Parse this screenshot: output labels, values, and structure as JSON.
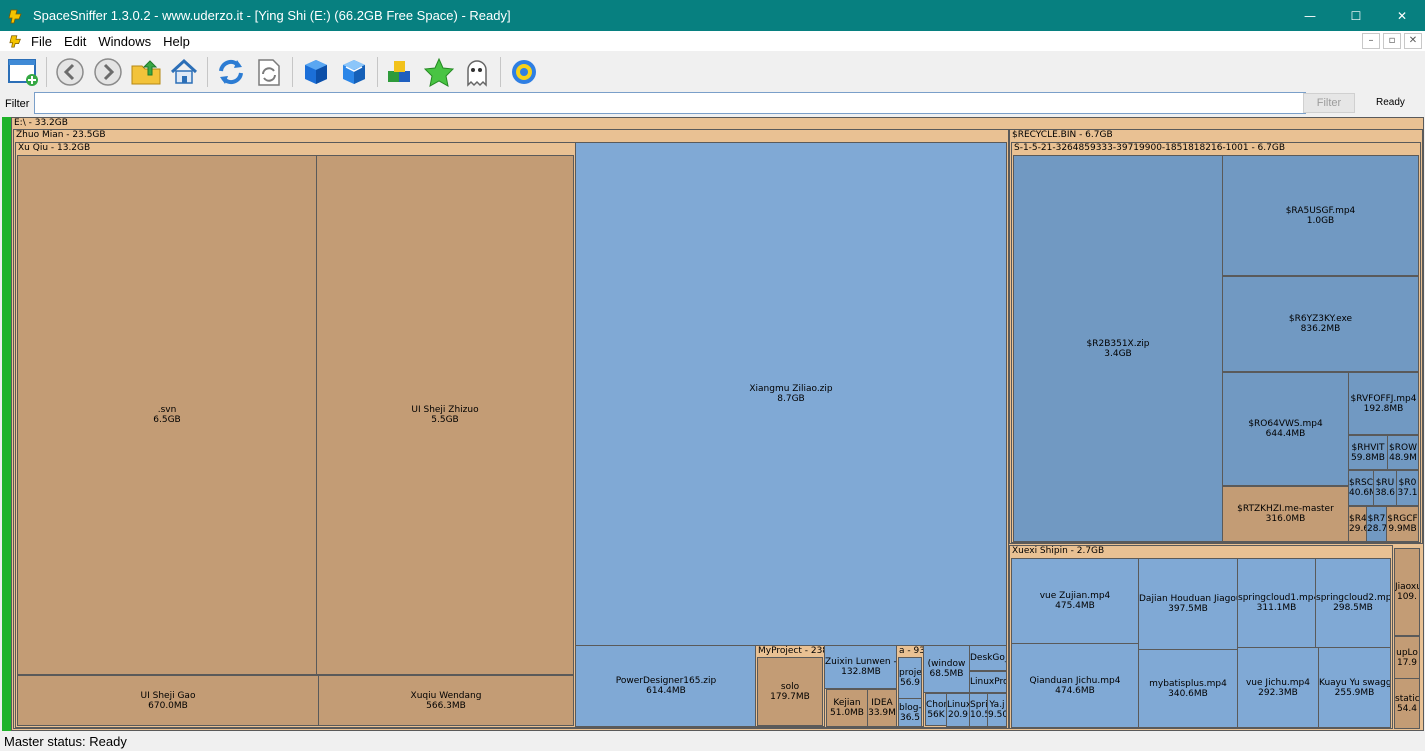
{
  "window": {
    "title": "SpaceSniffer 1.3.0.2 - www.uderzo.it - [Ying Shi (E:) (66.2GB Free Space) - Ready]",
    "minimize_glyph": "—",
    "maximize_glyph": "☐",
    "close_glyph": "✕"
  },
  "menu": {
    "items": [
      "File",
      "Edit",
      "Windows",
      "Help"
    ],
    "mdi_buttons": [
      "–",
      "▫",
      "✕"
    ]
  },
  "toolbar": {
    "buttons": [
      {
        "name": "new-view-button",
        "icon": "new-window-icon"
      },
      {
        "name": "back-button",
        "icon": "arrow-left-icon"
      },
      {
        "name": "forward-button",
        "icon": "arrow-right-icon"
      },
      {
        "name": "parent-folder-button",
        "icon": "folder-up-icon"
      },
      {
        "name": "home-button",
        "icon": "home-icon"
      },
      {
        "name": "refresh-button",
        "icon": "refresh-icon"
      },
      {
        "name": "refresh-item-button",
        "icon": "refresh-document-icon"
      },
      {
        "name": "zoom-in-button",
        "icon": "blue-cube-icon"
      },
      {
        "name": "zoom-out-button",
        "icon": "blue-cube-outline-icon"
      },
      {
        "name": "tags-button",
        "icon": "colored-blocks-icon"
      },
      {
        "name": "favorites-button",
        "icon": "star-icon"
      },
      {
        "name": "ghost-button",
        "icon": "ghost-icon"
      },
      {
        "name": "settings-button",
        "icon": "gear-icon"
      }
    ]
  },
  "filter": {
    "label": "Filter",
    "value": "",
    "button_label": "Filter",
    "status": "Ready"
  },
  "colors": {
    "titlebar": "#078080",
    "folder": "#e9c193",
    "file_brown": "#c39c75",
    "file_blue": "#80a9d5",
    "recycle_blue": "#7199c2",
    "progress_green": "#1fb32a"
  },
  "treemap": {
    "nodes": [
      {
        "id": "root",
        "kind": "folder",
        "header": "E:\\ - 33.2GB"
      },
      {
        "id": "desktop",
        "kind": "folder",
        "header": "Zhuo Mian - 23.5GB"
      },
      {
        "id": "requirements",
        "kind": "folder",
        "header": "Xu Qiu - 13.2GB"
      },
      {
        "id": "svn",
        "kind": "file_brown",
        "name": ".svn",
        "size": "6.5GB"
      },
      {
        "id": "ui-design",
        "kind": "file_brown",
        "name": "UI Sheji Zhizuo",
        "size": "5.5GB"
      },
      {
        "id": "ui-draft",
        "kind": "file_brown",
        "name": "UI Sheji Gao",
        "size": "670.0MB"
      },
      {
        "id": "req-docs",
        "kind": "file_brown",
        "name": "Xuqiu Wendang",
        "size": "566.3MB"
      },
      {
        "id": "project-zip",
        "kind": "file_blue",
        "name": "Xiangmu Ziliao.zip",
        "size": "8.7GB"
      },
      {
        "id": "powerdesigner",
        "kind": "file_blue",
        "name": "PowerDesigner165.zip",
        "size": "614.4MB"
      },
      {
        "id": "myproject",
        "kind": "folder",
        "header": "MyProject - 238"
      },
      {
        "id": "solo",
        "kind": "file_brown",
        "name": "solo",
        "size": "179.7MB"
      },
      {
        "id": "latest-papers",
        "kind": "file_blue",
        "name": "Zuixin Lunwen -Da",
        "size": "132.8MB"
      },
      {
        "id": "courseware",
        "kind": "file_brown",
        "name": "Kejian",
        "size": "51.0MB"
      },
      {
        "id": "idea",
        "kind": "file_brown",
        "name": "IDEA",
        "size": "33.9M"
      },
      {
        "id": "a-folder",
        "kind": "folder",
        "header": "a - 93"
      },
      {
        "id": "proj",
        "kind": "file_blue",
        "name": "proje",
        "size": "56.9"
      },
      {
        "id": "blog",
        "kind": "file_blue",
        "name": "blog-",
        "size": "36.5"
      },
      {
        "id": "windows",
        "kind": "file_blue",
        "name": "(window",
        "size": "68.5MB"
      },
      {
        "id": "chongqing",
        "kind": "file_blue",
        "name": "Chong",
        "size": "56K"
      },
      {
        "id": "linux",
        "kind": "file_blue",
        "name": "Linux",
        "size": "20.9"
      },
      {
        "id": "deskgo",
        "kind": "file_blue",
        "name": "DeskGo_",
        "size": ""
      },
      {
        "id": "linuxpro",
        "kind": "file_blue",
        "name": "LinuxPro",
        "size": ""
      },
      {
        "id": "spri",
        "kind": "file_blue",
        "name": "Spri",
        "size": "10.5"
      },
      {
        "id": "ya",
        "kind": "file_blue",
        "name": "Ya.j",
        "size": "9.50"
      },
      {
        "id": "recycle",
        "kind": "folder",
        "header": "$RECYCLE.BIN - 6.7GB"
      },
      {
        "id": "sid",
        "kind": "folder",
        "header": "S-1-5-21-3264859333-39719900-1851818216-1001 - 6.7GB"
      },
      {
        "id": "r2b351x",
        "kind": "recycle_blue",
        "name": "$R2B351X.zip",
        "size": "3.4GB"
      },
      {
        "id": "ra5usgf",
        "kind": "recycle_blue",
        "name": "$RA5USGF.mp4",
        "size": "1.0GB"
      },
      {
        "id": "r6yz3ky",
        "kind": "recycle_blue",
        "name": "$R6YZ3KY.exe",
        "size": "836.2MB"
      },
      {
        "id": "ro64vws",
        "kind": "recycle_blue",
        "name": "$RO64VWS.mp4",
        "size": "644.4MB"
      },
      {
        "id": "rtzkhzi",
        "kind": "file_brown",
        "name": "$RTZKHZI.me-master",
        "size": "316.0MB"
      },
      {
        "id": "rvfoffj",
        "kind": "recycle_blue",
        "name": "$RVFOFFJ.mp4",
        "size": "192.8MB"
      },
      {
        "id": "rhvit",
        "kind": "recycle_blue",
        "name": "$RHVIT",
        "size": "59.8MB"
      },
      {
        "id": "row",
        "kind": "recycle_blue",
        "name": "$ROW",
        "size": "48.9M"
      },
      {
        "id": "rsc",
        "kind": "recycle_blue",
        "name": "$RSC",
        "size": "40.6M"
      },
      {
        "id": "ru",
        "kind": "recycle_blue",
        "name": "$RU",
        "size": "38.6"
      },
      {
        "id": "r0",
        "kind": "recycle_blue",
        "name": "$R0",
        "size": "37.1"
      },
      {
        "id": "r4",
        "kind": "file_brown",
        "name": "$R4",
        "size": "29.6"
      },
      {
        "id": "r7",
        "kind": "recycle_blue",
        "name": "$R7",
        "size": "28.7"
      },
      {
        "id": "rgcf",
        "kind": "file_brown",
        "name": "$RGCF",
        "size": "9.9MB"
      },
      {
        "id": "study-video",
        "kind": "folder",
        "header": "Xuexi Shipin - 2.7GB"
      },
      {
        "id": "vue-comp",
        "kind": "file_blue",
        "name": "vue Zujian.mp4",
        "size": "475.4MB"
      },
      {
        "id": "frontend",
        "kind": "file_blue",
        "name": "Qianduan Jichu.mp4",
        "size": "474.6MB"
      },
      {
        "id": "build-backend",
        "kind": "file_blue",
        "name": "Dajian Houduan Jiagou.mp4",
        "size": "397.5MB"
      },
      {
        "id": "mybatisplus",
        "kind": "file_blue",
        "name": "mybatisplus.mp4",
        "size": "340.6MB"
      },
      {
        "id": "springcloud1",
        "kind": "file_blue",
        "name": "springcloud1.mp4",
        "size": "311.1MB"
      },
      {
        "id": "springcloud2",
        "kind": "file_blue",
        "name": "springcloud2.mp4",
        "size": "298.5MB"
      },
      {
        "id": "vue-basics",
        "kind": "file_blue",
        "name": "vue Jichu.mp4",
        "size": "292.3MB"
      },
      {
        "id": "swagger",
        "kind": "file_blue",
        "name": "Kuayu Yu swagger.m",
        "size": "255.9MB"
      },
      {
        "id": "teaching",
        "kind": "file_brown",
        "name": "Jiaoxue",
        "size": "109."
      },
      {
        "id": "uplo",
        "kind": "file_brown",
        "name": "upLo",
        "size": "17.9"
      },
      {
        "id": "static",
        "kind": "file_brown",
        "name": "static",
        "size": "54.4"
      }
    ]
  },
  "statusbar": {
    "text": "Master status: Ready"
  }
}
